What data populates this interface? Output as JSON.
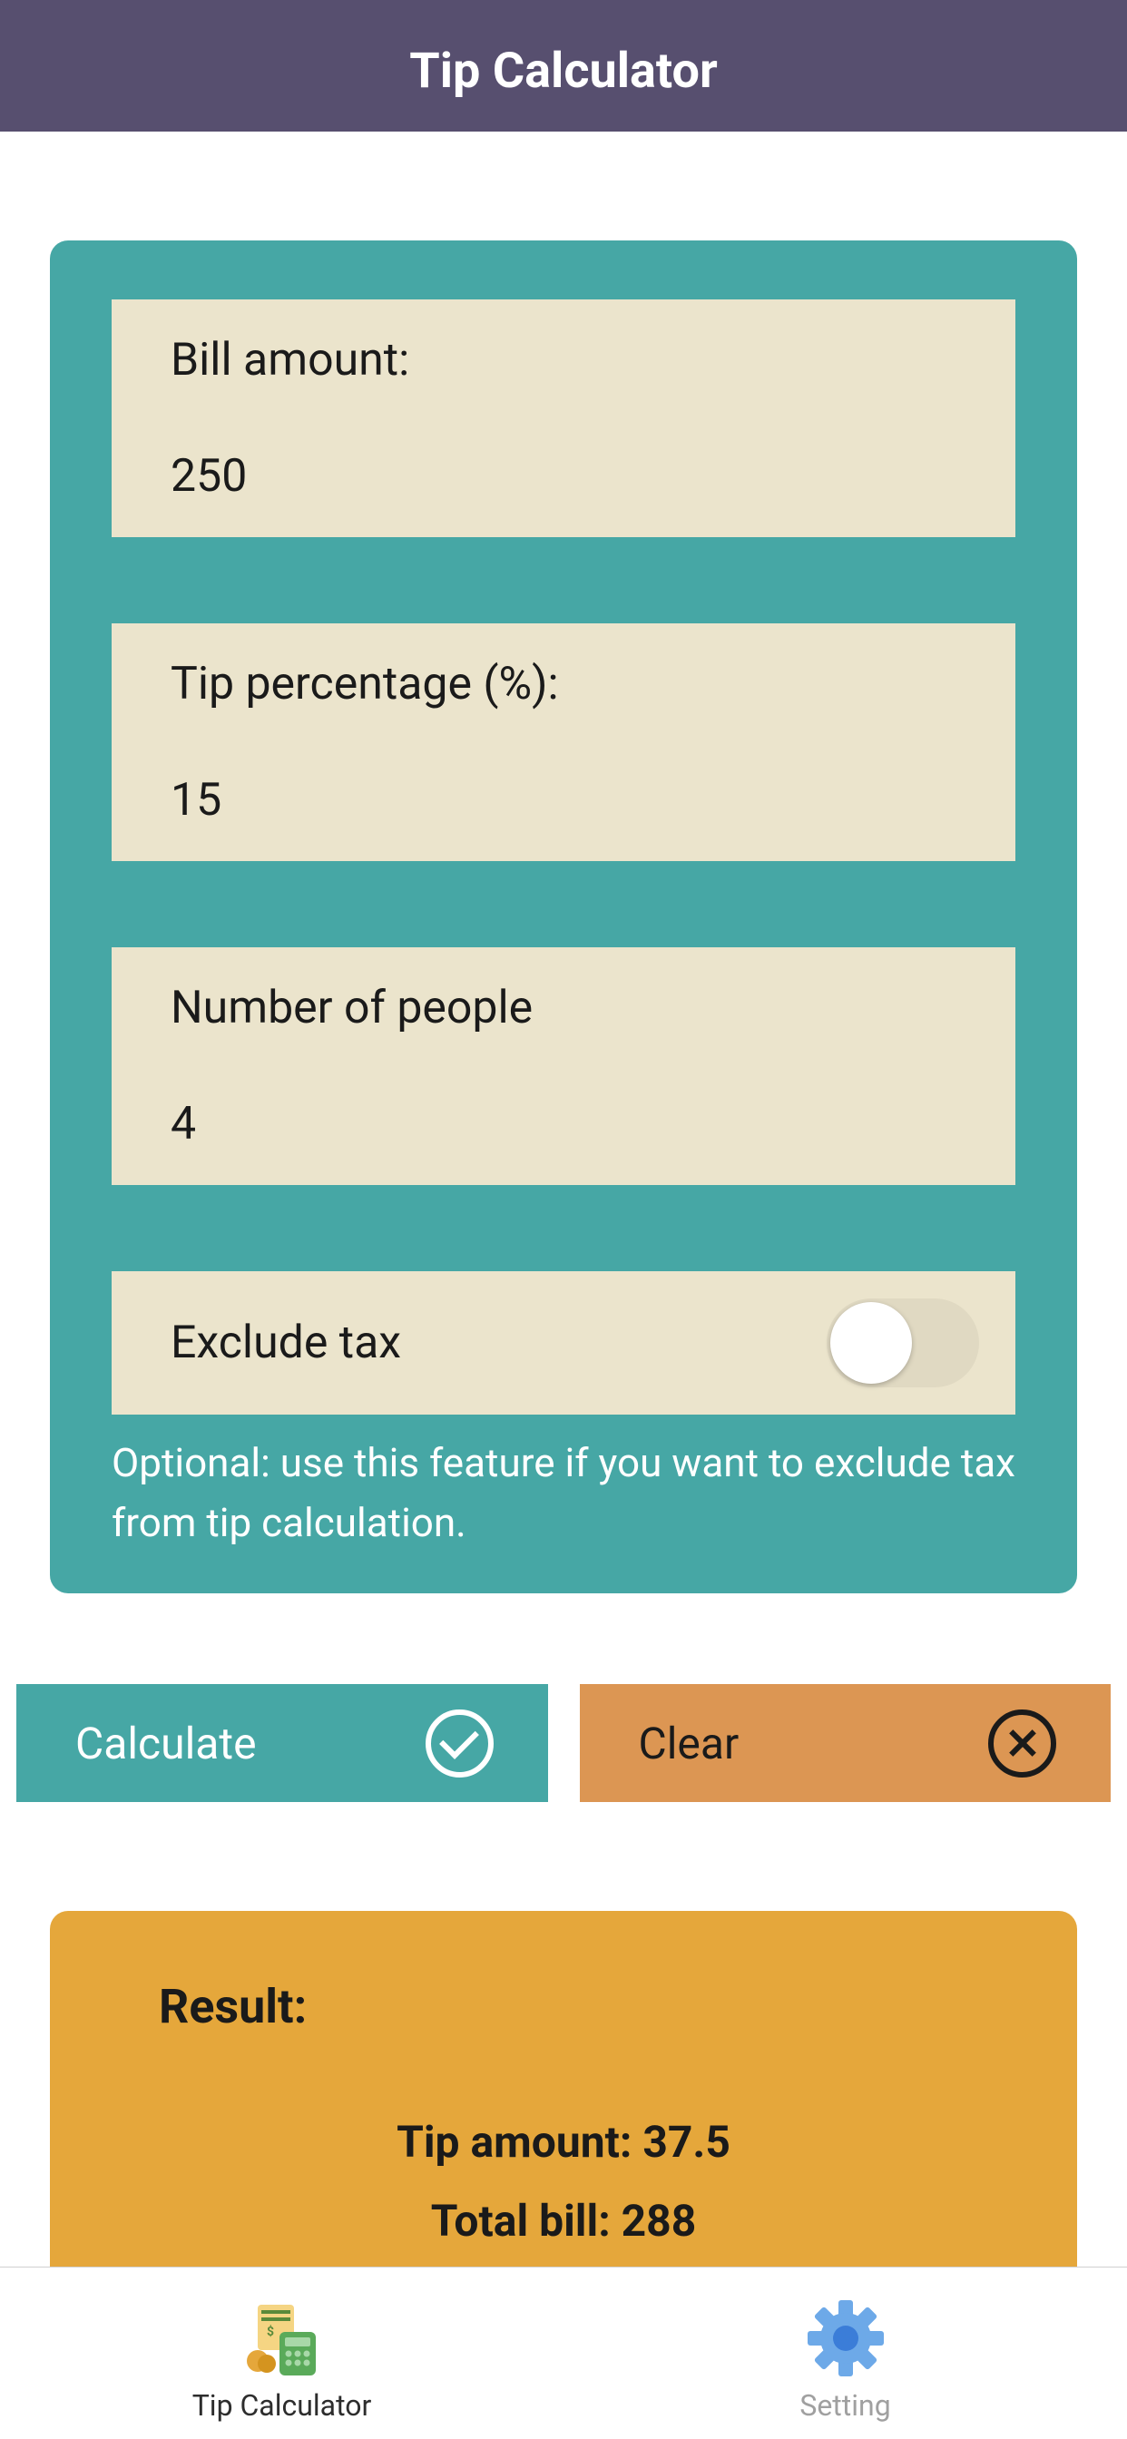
{
  "header": {
    "title": "Tip Calculator"
  },
  "form": {
    "billAmount": {
      "label": "Bill amount:",
      "value": "250"
    },
    "tipPercentage": {
      "label": "Tip percentage (%):",
      "value": "15"
    },
    "numberOfPeople": {
      "label": "Number of people",
      "value": "4"
    },
    "excludeTax": {
      "label": "Exclude tax",
      "hint": "Optional: use this feature if you want to exclude tax from tip calculation."
    }
  },
  "buttons": {
    "calculate": "Calculate",
    "clear": "Clear"
  },
  "result": {
    "title": "Result:",
    "tipAmount": "Tip amount: 37.5",
    "totalBill": "Total bill: 288"
  },
  "tabs": {
    "calculator": "Tip Calculator",
    "setting": "Setting"
  }
}
